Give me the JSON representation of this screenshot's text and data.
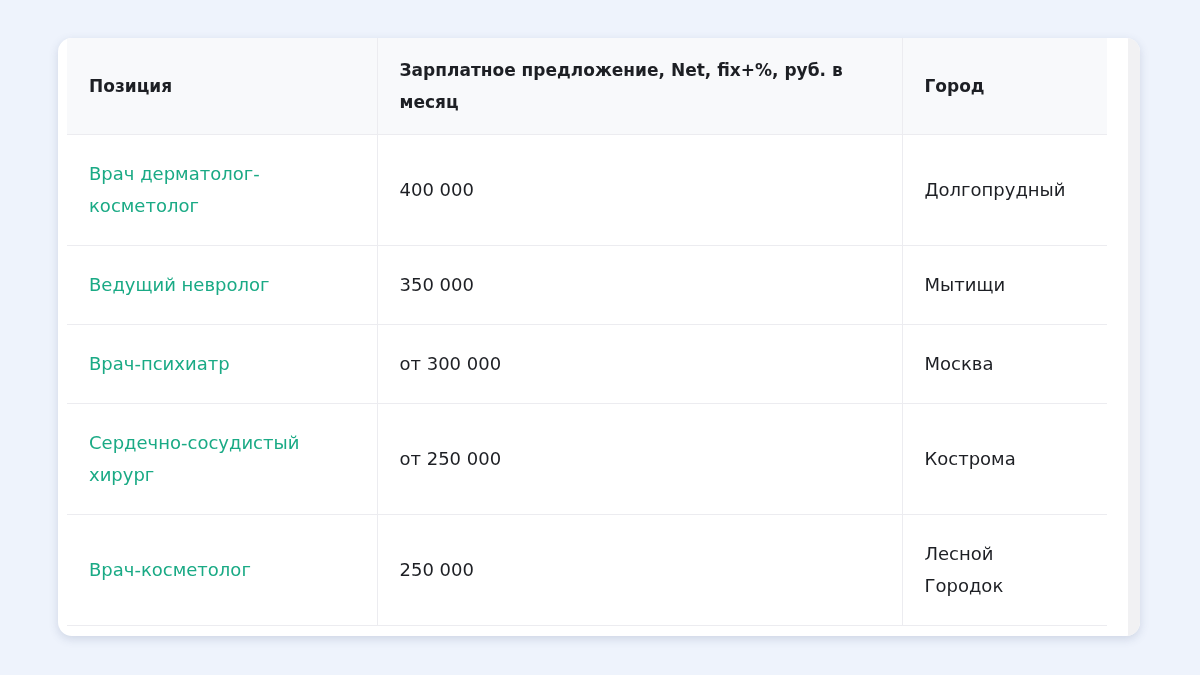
{
  "table": {
    "columns": [
      "Позиция",
      "Зарплатное предложение, Net, fix+%, руб. в месяц",
      "Город"
    ],
    "rows": [
      {
        "position": "Врач дерматолог-косметолог",
        "salary": "400 000",
        "city": "Долгопрудный"
      },
      {
        "position": "Ведущий невролог",
        "salary": "350 000",
        "city": "Мытищи"
      },
      {
        "position": "Врач-психиатр",
        "salary": "от 300 000",
        "city": "Москва"
      },
      {
        "position": "Сердечно-сосудистый хирург",
        "salary": "от 250 000",
        "city": "Кострома"
      },
      {
        "position": "Врач-косметолог",
        "salary": "250 000",
        "city": "Лесной Городок"
      }
    ]
  }
}
